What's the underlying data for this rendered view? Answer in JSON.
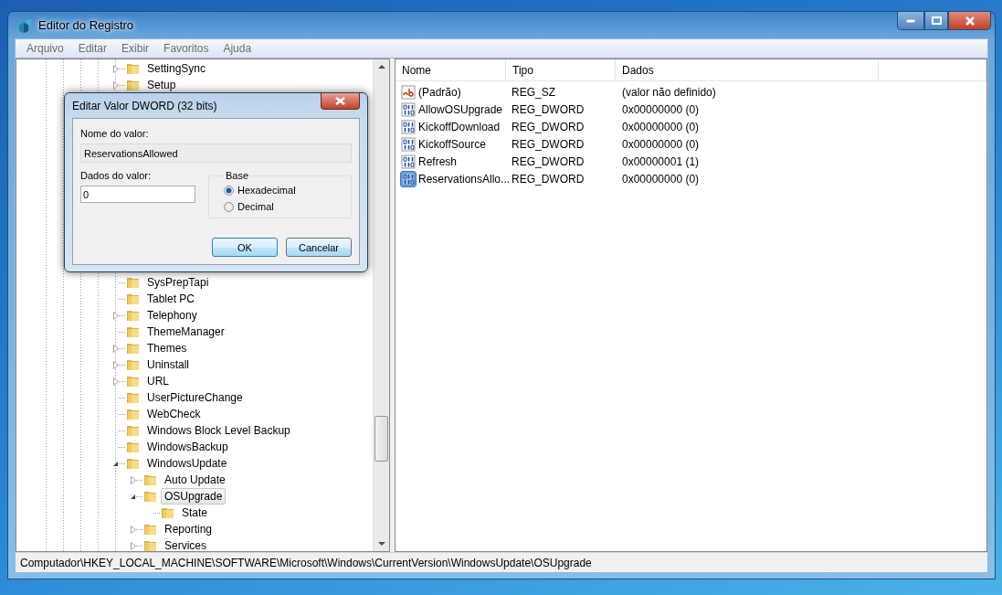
{
  "window": {
    "title": "Editor do Registro"
  },
  "menu": [
    "Arquivo",
    "Editar",
    "Exibir",
    "Favoritos",
    "Ajuda"
  ],
  "tree": {
    "items": [
      {
        "label": "SettingSync",
        "kind": "branch",
        "expanded": false,
        "selected": false
      },
      {
        "label": "Setup",
        "kind": "branch",
        "expanded": false,
        "selected": false
      },
      {
        "label": "SysPrepTapi",
        "kind": "leaf",
        "selected": false,
        "after_hidden": true
      },
      {
        "label": "Tablet PC",
        "kind": "leaf",
        "selected": false
      },
      {
        "label": "Telephony",
        "kind": "branch",
        "expanded": false,
        "selected": false
      },
      {
        "label": "ThemeManager",
        "kind": "leaf",
        "selected": false
      },
      {
        "label": "Themes",
        "kind": "branch",
        "expanded": false,
        "selected": false
      },
      {
        "label": "Uninstall",
        "kind": "branch",
        "expanded": false,
        "selected": false
      },
      {
        "label": "URL",
        "kind": "branch",
        "expanded": false,
        "selected": false
      },
      {
        "label": "UserPictureChange",
        "kind": "leaf",
        "selected": false
      },
      {
        "label": "WebCheck",
        "kind": "leaf",
        "selected": false
      },
      {
        "label": "Windows Block Level Backup",
        "kind": "leaf",
        "selected": false
      },
      {
        "label": "WindowsBackup",
        "kind": "leaf",
        "selected": false
      },
      {
        "label": "WindowsUpdate",
        "kind": "branch",
        "expanded": true,
        "selected": false,
        "children": [
          {
            "label": "Auto Update",
            "kind": "branch",
            "expanded": false,
            "selected": false
          },
          {
            "label": "OSUpgrade",
            "kind": "branch",
            "expanded": true,
            "selected": true,
            "children": [
              {
                "label": "State",
                "kind": "leaf",
                "selected": false
              }
            ]
          },
          {
            "label": "Reporting",
            "kind": "branch",
            "expanded": false,
            "selected": false
          },
          {
            "label": "Services",
            "kind": "branch",
            "expanded": false,
            "selected": false
          }
        ]
      }
    ]
  },
  "values": {
    "columns": [
      "Nome",
      "Tipo",
      "Dados"
    ],
    "rows": [
      {
        "kind": "string",
        "name": "(Padrão)",
        "type": "REG_SZ",
        "data": "(valor não definido)",
        "selected": false
      },
      {
        "kind": "binary",
        "name": "AllowOSUpgrade",
        "type": "REG_DWORD",
        "data": "0x00000000 (0)",
        "selected": false
      },
      {
        "kind": "binary",
        "name": "KickoffDownload",
        "type": "REG_DWORD",
        "data": "0x00000000 (0)",
        "selected": false
      },
      {
        "kind": "binary",
        "name": "KickoffSource",
        "type": "REG_DWORD",
        "data": "0x00000000 (0)",
        "selected": false
      },
      {
        "kind": "binary",
        "name": "Refresh",
        "type": "REG_DWORD",
        "data": "0x00000001 (1)",
        "selected": false
      },
      {
        "kind": "binary",
        "name": "ReservationsAllo...",
        "type": "REG_DWORD",
        "data": "0x00000000 (0)",
        "selected": true
      }
    ]
  },
  "status_bar": "Computador\\HKEY_LOCAL_MACHINE\\SOFTWARE\\Microsoft\\Windows\\CurrentVersion\\WindowsUpdate\\OSUpgrade",
  "dialog": {
    "title": "Editar Valor DWORD (32 bits)",
    "name_label": "Nome do valor:",
    "name_value": "ReservationsAllowed",
    "data_label": "Dados do valor:",
    "data_value": "0",
    "base_label": "Base",
    "base_options": [
      {
        "label": "Hexadecimal",
        "selected": true
      },
      {
        "label": "Decimal",
        "selected": false
      }
    ],
    "buttons": [
      "OK",
      "Cancelar"
    ]
  }
}
